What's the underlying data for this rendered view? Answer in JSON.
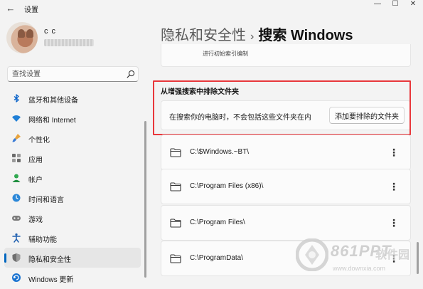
{
  "window": {
    "title": "设置",
    "controls": {
      "minimize": "—",
      "maximize": "☐",
      "close": "✕"
    }
  },
  "profile": {
    "name": "c c"
  },
  "search": {
    "placeholder": "查找设置"
  },
  "sidebar": {
    "items": [
      {
        "label": "蓝牙和其他设备",
        "icon": "bluetooth-icon",
        "active": false
      },
      {
        "label": "网络和 Internet",
        "icon": "wifi-icon",
        "active": false
      },
      {
        "label": "个性化",
        "icon": "brush-icon",
        "active": false
      },
      {
        "label": "应用",
        "icon": "apps-icon",
        "active": false
      },
      {
        "label": "帐户",
        "icon": "person-icon",
        "active": false
      },
      {
        "label": "时间和语言",
        "icon": "globe-clock-icon",
        "active": false
      },
      {
        "label": "游戏",
        "icon": "gamepad-icon",
        "active": false
      },
      {
        "label": "辅助功能",
        "icon": "accessibility-icon",
        "active": false
      },
      {
        "label": "隐私和安全性",
        "icon": "shield-icon",
        "active": true
      },
      {
        "label": "Windows 更新",
        "icon": "update-icon",
        "active": false
      }
    ]
  },
  "main": {
    "breadcrumb": {
      "parent": "隐私和安全性",
      "separator": "›",
      "current": "搜索 Windows"
    },
    "top_card_text": "进行初始索引编制",
    "exclude_section": {
      "title": "从增强搜索中排除文件夹",
      "description": "在搜索你的电脑时，不会包括这些文件夹在内",
      "add_button": "添加要排除的文件夹"
    },
    "folders": [
      {
        "path": "C:\\$Windows.~BT\\"
      },
      {
        "path": "C:\\Program Files (x86)\\"
      },
      {
        "path": "C:\\Program Files\\"
      },
      {
        "path": "C:\\ProgramData\\"
      }
    ],
    "more_glyph": "⋮"
  },
  "watermark": {
    "brand": "861PPT",
    "brand_cn": "软件园",
    "url": "www.downxia.com"
  },
  "colors": {
    "accent": "#0067c0",
    "highlight_box": "#e8373b",
    "background": "#f3f3f3",
    "card": "#fbfbfb"
  }
}
